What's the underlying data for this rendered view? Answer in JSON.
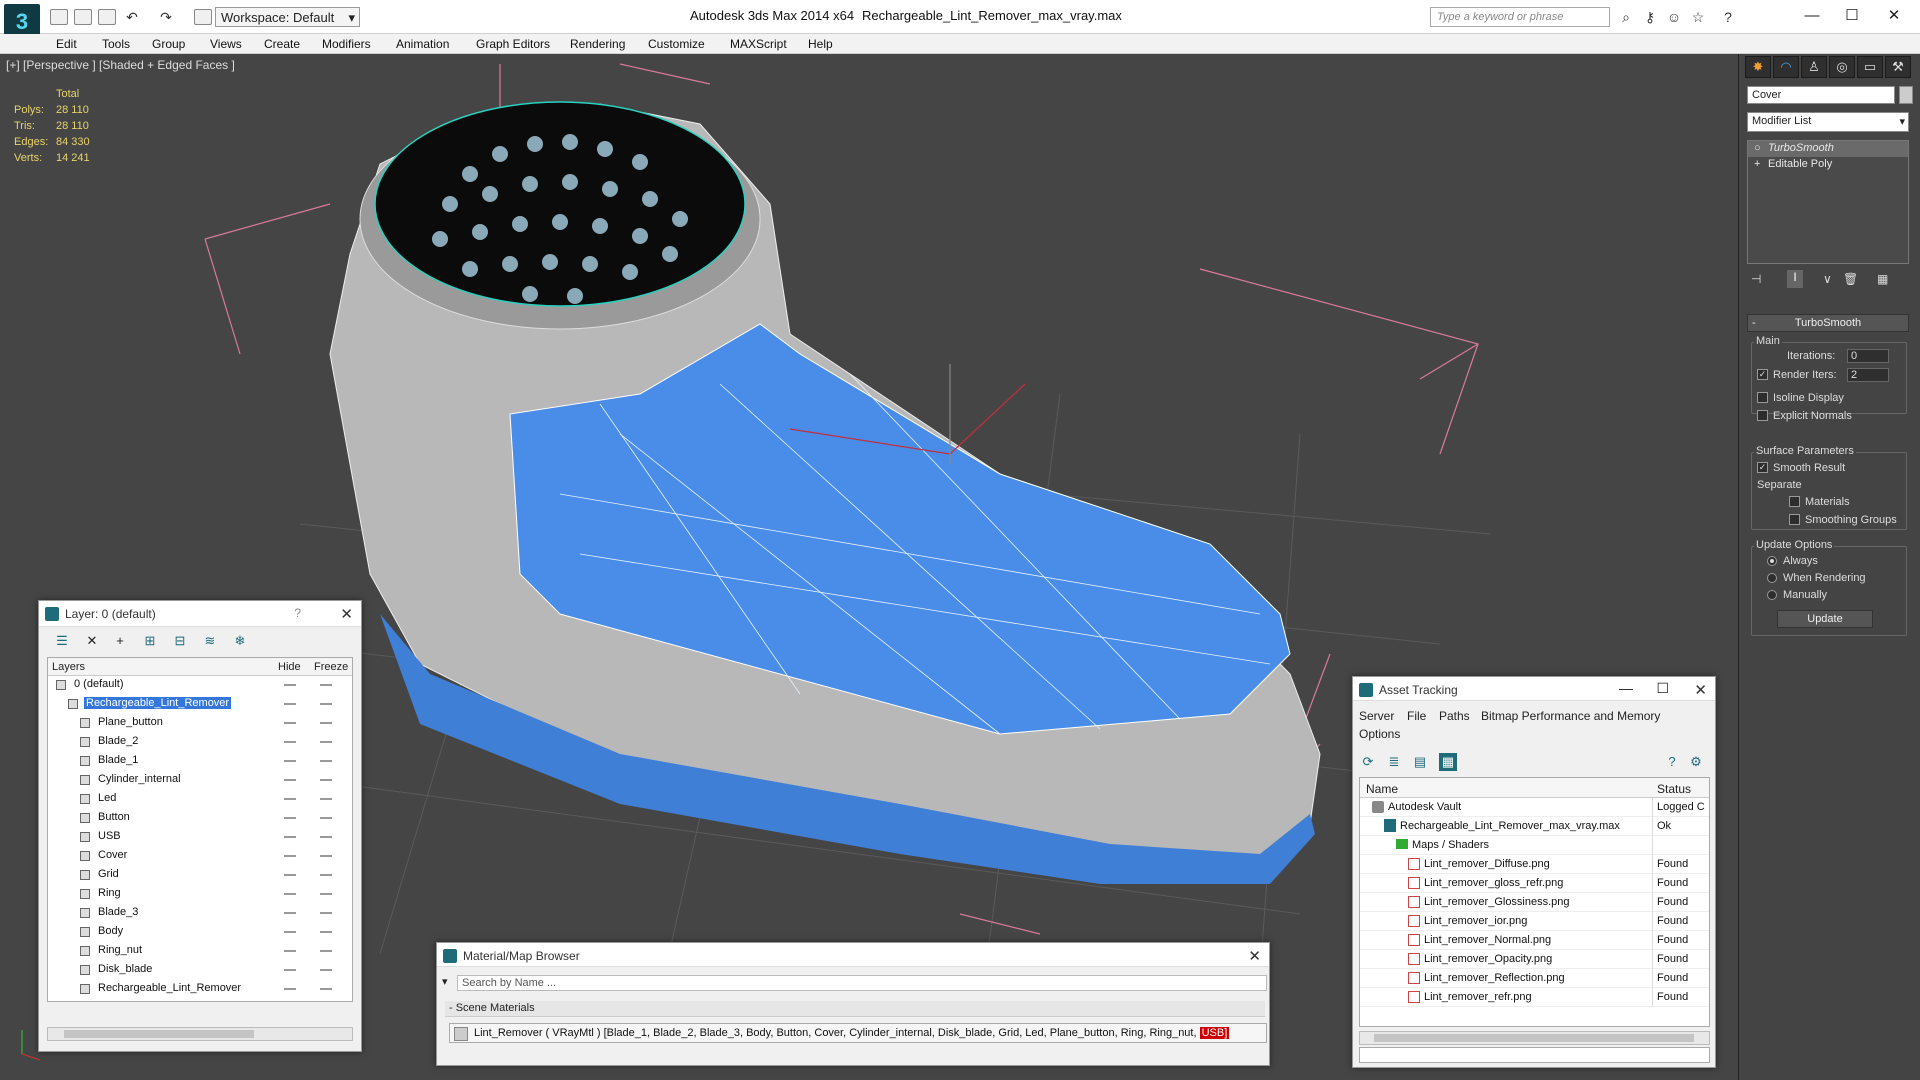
{
  "app": {
    "title": "Autodesk 3ds Max  2014 x64",
    "file": "Rechargeable_Lint_Remover_max_vray.max",
    "workspace": "Workspace: Default",
    "search_placeholder": "Type a keyword or phrase"
  },
  "menu": [
    "Edit",
    "Tools",
    "Group",
    "Views",
    "Create",
    "Modifiers",
    "Animation",
    "Graph Editors",
    "Rendering",
    "Customize",
    "MAXScript",
    "Help"
  ],
  "viewport": {
    "label": "[+] [Perspective ] [Shaded + Edged Faces ]",
    "stats": {
      "header": "Total",
      "rows": [
        {
          "label": "Polys:",
          "value": "28 110"
        },
        {
          "label": "Tris:",
          "value": "28 110"
        },
        {
          "label": "Edges:",
          "value": "84 330"
        },
        {
          "label": "Verts:",
          "value": "14 241"
        }
      ]
    }
  },
  "command_panel": {
    "object_name": "Cover",
    "modifier_list": "Modifier List",
    "stack": [
      "TurboSmooth",
      "Editable Poly"
    ],
    "rollout_title": "TurboSmooth",
    "main_label": "Main",
    "iterations_label": "Iterations:",
    "iterations_value": "0",
    "render_iters_label": "Render Iters:",
    "render_iters_value": "2",
    "isoline": "Isoline Display",
    "explicit_normals": "Explicit Normals",
    "surface_params": "Surface Parameters",
    "smooth_result": "Smooth Result",
    "separate": "Separate",
    "materials": "Materials",
    "smoothing_groups": "Smoothing Groups",
    "update_options": "Update Options",
    "always": "Always",
    "when_rendering": "When Rendering",
    "manually": "Manually",
    "update_btn": "Update"
  },
  "layer_panel": {
    "title": "Layer: 0 (default)",
    "help": "?",
    "col_layers": "Layers",
    "col_hide": "Hide",
    "col_freeze": "Freeze",
    "rows": [
      {
        "name": "0 (default)",
        "indent": 0,
        "selected": false
      },
      {
        "name": "Rechargeable_Lint_Remover",
        "indent": 1,
        "selected": true
      },
      {
        "name": "Plane_button",
        "indent": 2,
        "selected": false
      },
      {
        "name": "Blade_2",
        "indent": 2,
        "selected": false
      },
      {
        "name": "Blade_1",
        "indent": 2,
        "selected": false
      },
      {
        "name": "Cylinder_internal",
        "indent": 2,
        "selected": false
      },
      {
        "name": "Led",
        "indent": 2,
        "selected": false
      },
      {
        "name": "Button",
        "indent": 2,
        "selected": false
      },
      {
        "name": "USB",
        "indent": 2,
        "selected": false
      },
      {
        "name": "Cover",
        "indent": 2,
        "selected": false
      },
      {
        "name": "Grid",
        "indent": 2,
        "selected": false
      },
      {
        "name": "Ring",
        "indent": 2,
        "selected": false
      },
      {
        "name": "Blade_3",
        "indent": 2,
        "selected": false
      },
      {
        "name": "Body",
        "indent": 2,
        "selected": false
      },
      {
        "name": "Ring_nut",
        "indent": 2,
        "selected": false
      },
      {
        "name": "Disk_blade",
        "indent": 2,
        "selected": false
      },
      {
        "name": "Rechargeable_Lint_Remover",
        "indent": 2,
        "selected": false
      }
    ]
  },
  "asset_panel": {
    "title": "Asset Tracking",
    "menu": [
      "Server",
      "File",
      "Paths",
      "Bitmap Performance and Memory",
      "Options"
    ],
    "col_name": "Name",
    "col_status": "Status",
    "rows": [
      {
        "name": "Autodesk Vault",
        "status": "Logged C",
        "indent": 1,
        "type": "vault"
      },
      {
        "name": "Rechargeable_Lint_Remover_max_vray.max",
        "status": "Ok",
        "indent": 2,
        "type": "max"
      },
      {
        "name": "Maps / Shaders",
        "status": "",
        "indent": 3,
        "type": "folder"
      },
      {
        "name": "Lint_remover_Diffuse.png",
        "status": "Found",
        "indent": 4,
        "type": "png"
      },
      {
        "name": "Lint_remover_gloss_refr.png",
        "status": "Found",
        "indent": 4,
        "type": "png"
      },
      {
        "name": "Lint_remover_Glossiness.png",
        "status": "Found",
        "indent": 4,
        "type": "png"
      },
      {
        "name": "Lint_remover_ior.png",
        "status": "Found",
        "indent": 4,
        "type": "png"
      },
      {
        "name": "Lint_remover_Normal.png",
        "status": "Found",
        "indent": 4,
        "type": "png"
      },
      {
        "name": "Lint_remover_Opacity.png",
        "status": "Found",
        "indent": 4,
        "type": "png"
      },
      {
        "name": "Lint_remover_Reflection.png",
        "status": "Found",
        "indent": 4,
        "type": "png"
      },
      {
        "name": "Lint_remover_refr.png",
        "status": "Found",
        "indent": 4,
        "type": "png"
      }
    ]
  },
  "material_panel": {
    "title": "Material/Map Browser",
    "search": "Search by Name ...",
    "scene_header": "- Scene Materials",
    "material_text": "Lint_Remover  ( VRayMtl ) [Blade_1, Blade_2, Blade_3, Body, Button, Cover, Cylinder_internal, Disk_blade, Grid, Led, Plane_button, Ring, Ring_nut, ",
    "material_highlight": "USB]"
  }
}
